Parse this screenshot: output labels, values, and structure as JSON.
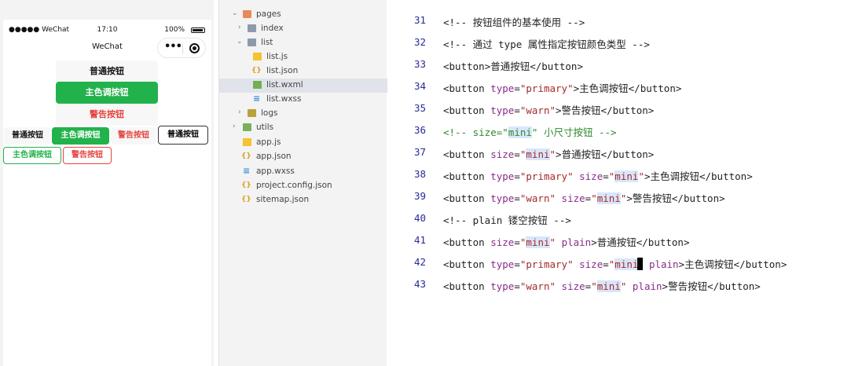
{
  "simulator": {
    "status_signal": "●●●●● WeChat",
    "status_time": "17:10",
    "status_battery": "100%",
    "nav_title": "WeChat",
    "buttons": {
      "default": "普通按钮",
      "primary": "主色调按钮",
      "warn": "警告按钮",
      "mini_default": "普通按钮",
      "mini_primary": "主色调按钮",
      "mini_warn": "警告按钮",
      "plain_default": "普通按钮",
      "plain_primary": "主色调按钮",
      "plain_warn": "警告按钮"
    },
    "colors": {
      "primary": "#22b24c",
      "warn": "#e64340"
    }
  },
  "file_tree": {
    "items": [
      {
        "label": "pages",
        "kind": "folder",
        "expanded": true
      },
      {
        "label": "index",
        "kind": "folder",
        "expanded": false
      },
      {
        "label": "list",
        "kind": "folder",
        "expanded": true
      },
      {
        "label": "list.js",
        "kind": "js"
      },
      {
        "label": "list.json",
        "kind": "json"
      },
      {
        "label": "list.wxml",
        "kind": "wxml",
        "selected": true
      },
      {
        "label": "list.wxss",
        "kind": "wxss"
      },
      {
        "label": "logs",
        "kind": "folder",
        "expanded": false
      },
      {
        "label": "utils",
        "kind": "folder",
        "expanded": false
      },
      {
        "label": "app.js",
        "kind": "js"
      },
      {
        "label": "app.json",
        "kind": "json"
      },
      {
        "label": "app.wxss",
        "kind": "wxss"
      },
      {
        "label": "project.config.json",
        "kind": "json"
      },
      {
        "label": "sitemap.json",
        "kind": "json"
      }
    ]
  },
  "editor": {
    "lines": [
      {
        "num": "31",
        "text": "<!-- 按钮组件的基本使用 -->"
      },
      {
        "num": "32",
        "text": "<!-- 通过 type 属性指定按钮颜色类型 -->"
      },
      {
        "num": "33",
        "text": "<button>普通按钮</button>"
      },
      {
        "num": "34",
        "text": "<button type=\"primary\">主色调按钮</button>"
      },
      {
        "num": "35",
        "text": "<button type=\"warn\">警告按钮</button>"
      },
      {
        "num": "36",
        "text": "<!-- size=\"mini\" 小尺寸按钮 -->"
      },
      {
        "num": "37",
        "text": "<button size=\"mini\">普通按钮</button>"
      },
      {
        "num": "38",
        "text": "<button type=\"primary\" size=\"mini\">主色调按钮</button>"
      },
      {
        "num": "39",
        "text": "<button type=\"warn\" size=\"mini\">警告按钮</button>"
      },
      {
        "num": "40",
        "text": "<!-- plain 镂空按钮 -->"
      },
      {
        "num": "41",
        "text": "<button size=\"mini\" plain>普通按钮</button>"
      },
      {
        "num": "42",
        "text": "<button type=\"primary\" size=\"mini\" plain>主色调按钮</button>"
      },
      {
        "num": "43",
        "text": "<button type=\"warn\" size=\"mini\" plain>警告按钮</button>"
      }
    ]
  }
}
